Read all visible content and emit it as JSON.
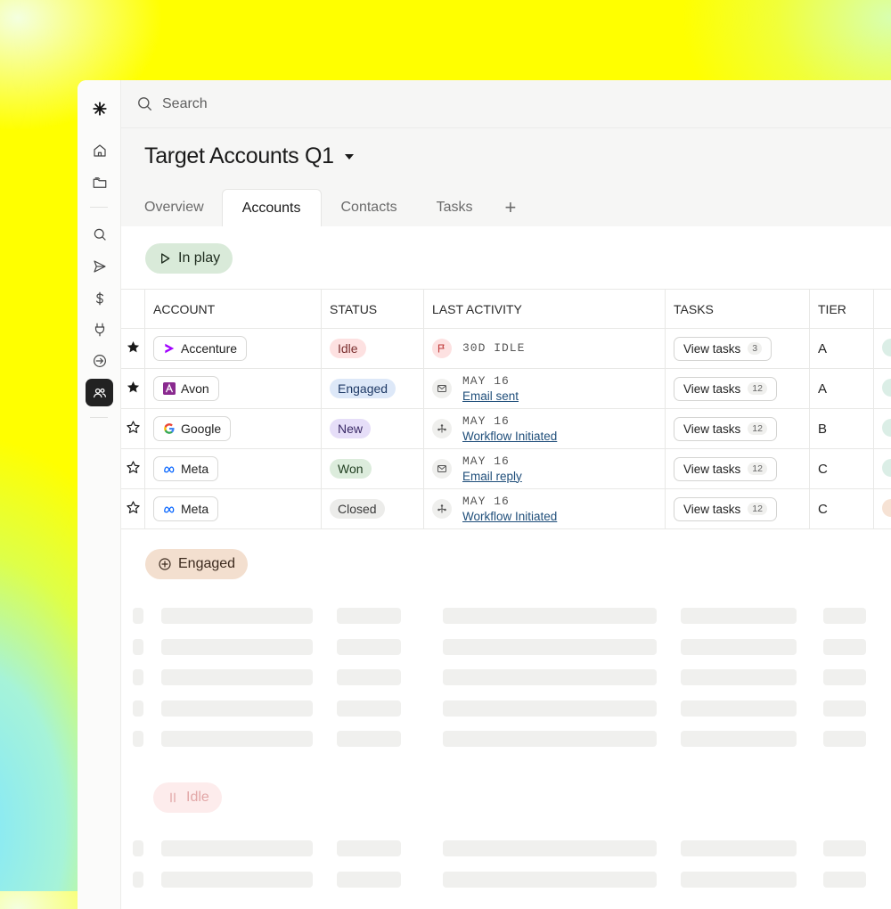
{
  "search": {
    "placeholder": "Search"
  },
  "header": {
    "title": "Target Accounts Q1"
  },
  "tabs": [
    {
      "label": "Overview"
    },
    {
      "label": "Accounts"
    },
    {
      "label": "Contacts"
    },
    {
      "label": "Tasks"
    },
    {
      "label": "+"
    }
  ],
  "groups": {
    "in_play": "In play",
    "engaged": "Engaged",
    "idle": "Idle"
  },
  "columns": {
    "account": "ACCOUNT",
    "status": "STATUS",
    "last_activity": "LAST ACTIVITY",
    "tasks": "TASKS",
    "tier": "TIER"
  },
  "rows": [
    {
      "starred": true,
      "account": "Accenture",
      "logo": "accenture-logo",
      "status": "Idle",
      "activity_date": "30D IDLE",
      "activity_link": "",
      "activity_icon": "flag-icon",
      "tasks_label": "View tasks",
      "tasks_count": "3",
      "tier": "A"
    },
    {
      "starred": true,
      "account": "Avon",
      "logo": "avon-logo",
      "status": "Engaged",
      "activity_date": "MAY 16",
      "activity_link": "Email sent",
      "activity_icon": "mail-icon",
      "tasks_label": "View tasks",
      "tasks_count": "12",
      "tier": "A"
    },
    {
      "starred": false,
      "account": "Google",
      "logo": "google-logo",
      "status": "New",
      "activity_date": "MAY 16",
      "activity_link": "Workflow Initiated",
      "activity_icon": "workflow-icon",
      "tasks_label": "View tasks",
      "tasks_count": "12",
      "tier": "B"
    },
    {
      "starred": false,
      "account": "Meta",
      "logo": "meta-logo",
      "status": "Won",
      "activity_date": "MAY 16",
      "activity_link": "Email reply",
      "activity_icon": "mail-icon",
      "tasks_label": "View tasks",
      "tasks_count": "12",
      "tier": "C"
    },
    {
      "starred": false,
      "account": "Meta",
      "logo": "meta-logo",
      "status": "Closed",
      "activity_date": "MAY 16",
      "activity_link": "Workflow Initiated",
      "activity_icon": "workflow-icon",
      "tasks_label": "View tasks",
      "tasks_count": "12",
      "tier": "C"
    }
  ],
  "status_colors": {
    "Idle": {
      "bg": "#fde1e1",
      "fg": "#7a2e2e"
    },
    "Engaged": {
      "bg": "#dde8f8",
      "fg": "#1f3a66"
    },
    "New": {
      "bg": "#e6def8",
      "fg": "#3a2a66"
    },
    "Won": {
      "bg": "#dcecdc",
      "fg": "#1f3d1f"
    },
    "Closed": {
      "bg": "#ececea",
      "fg": "#3a3a3a"
    }
  },
  "colors": {
    "background_accent": "#ffff00",
    "in_play_pill": "#d9ead9",
    "engaged_pill": "#f3dfcf",
    "idle_pill": "#fdecec",
    "link": "#1f4e7a"
  },
  "sidebar": {
    "icons": [
      "logo-icon",
      "home-icon",
      "folder-icon",
      "search-icon",
      "send-icon",
      "dollar-icon",
      "plug-icon",
      "sign-in-icon",
      "users-icon"
    ],
    "active": "users-icon"
  }
}
